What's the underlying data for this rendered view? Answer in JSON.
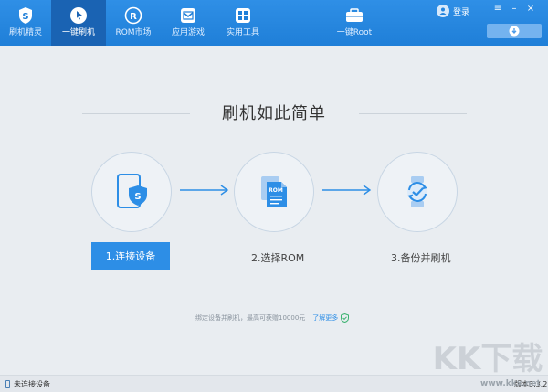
{
  "nav": {
    "items": [
      {
        "label": "刷机精灵",
        "icon": "shield-s-logo-icon"
      },
      {
        "label": "一键刷机",
        "icon": "cursor-arrow-icon"
      },
      {
        "label": "ROM市场",
        "icon": "r-circle-icon"
      },
      {
        "label": "应用游戏",
        "icon": "mail-box-icon"
      },
      {
        "label": "实用工具",
        "icon": "grid-tools-icon"
      },
      {
        "label": "一键Root",
        "icon": "root-toolbox-icon"
      }
    ],
    "active_index": 1
  },
  "header": {
    "login_label": "登录",
    "window_buttons": [
      "menu",
      "minimize",
      "close"
    ]
  },
  "main": {
    "title": "刷机如此简单",
    "steps": [
      {
        "label": "1.连接设备",
        "icon": "phone-shield-icon",
        "active": true
      },
      {
        "label": "2.选择ROM",
        "icon": "rom-files-icon",
        "active": false
      },
      {
        "label": "3.备份并刷机",
        "icon": "watch-refresh-icon",
        "active": false
      }
    ],
    "promo_text": "绑定设备并刷机，最高可获赠10000元",
    "promo_link": "了解更多"
  },
  "status": {
    "connection": "未连接设备",
    "version": "版本3.3.2"
  },
  "watermark": {
    "logo": "KK下载",
    "site": "www.kkx.net"
  },
  "colors": {
    "topbar": "#2485de",
    "nav_active": "#1a63b3",
    "primary": "#2d8ee6",
    "background": "#e9edf1"
  }
}
